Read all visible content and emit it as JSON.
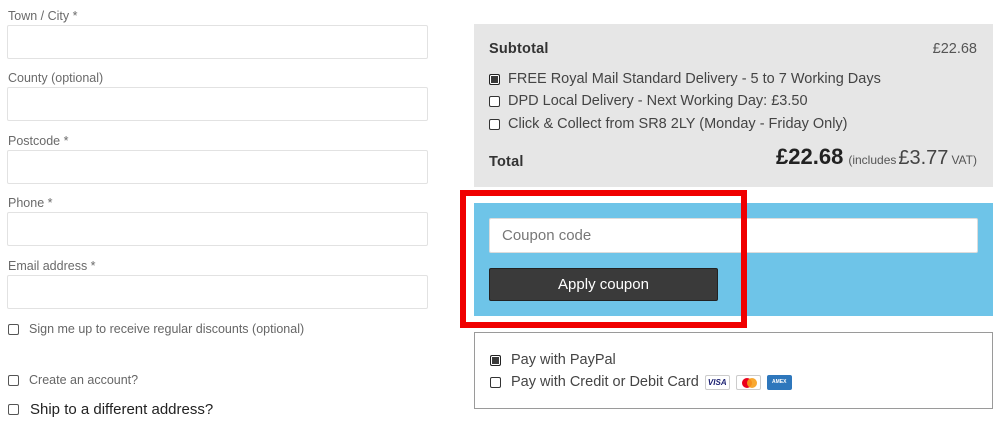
{
  "form": {
    "town": {
      "label": "Town / City *",
      "value": "",
      "placeholder": ""
    },
    "county": {
      "label": "County (optional)",
      "value": "",
      "placeholder": ""
    },
    "postcode": {
      "label": "Postcode *",
      "value": "",
      "placeholder": ""
    },
    "phone": {
      "label": "Phone *",
      "value": "",
      "placeholder": ""
    },
    "email": {
      "label": "Email address *",
      "value": "",
      "placeholder": ""
    },
    "signup_label": "Sign me up to receive regular discounts (optional)",
    "create_account_label": "Create an account?",
    "ship_different_label": "Ship to a different address?"
  },
  "summary": {
    "subtotal_label": "Subtotal",
    "subtotal_value": "£22.68",
    "shipping_options": [
      {
        "label": "FREE Royal Mail Standard Delivery - 5 to 7 Working Days",
        "checked": true
      },
      {
        "label": "DPD Local Delivery - Next Working Day: £3.50",
        "checked": false
      },
      {
        "label": "Click & Collect from SR8 2LY (Monday - Friday Only)",
        "checked": false
      }
    ],
    "total_label": "Total",
    "total_value": "£22.68",
    "includes_label": "(includes",
    "vat_value": "£3.77",
    "vat_label": "VAT)"
  },
  "coupon": {
    "placeholder": "Coupon code",
    "value": "",
    "button_label": "Apply coupon"
  },
  "payment": {
    "options": [
      {
        "label": "Pay with PayPal",
        "checked": true
      },
      {
        "label": "Pay with Credit or Debit Card",
        "checked": false
      }
    ],
    "card_icons": [
      "visa-icon",
      "mastercard-icon",
      "amex-icon"
    ],
    "visa_text": "VISA",
    "amex_text": "AMEX"
  },
  "colors": {
    "summary_bg": "#e6e6e6",
    "coupon_bg": "#6ec4e8",
    "button_bg": "#3a3a3a",
    "highlight": "#f00000"
  }
}
